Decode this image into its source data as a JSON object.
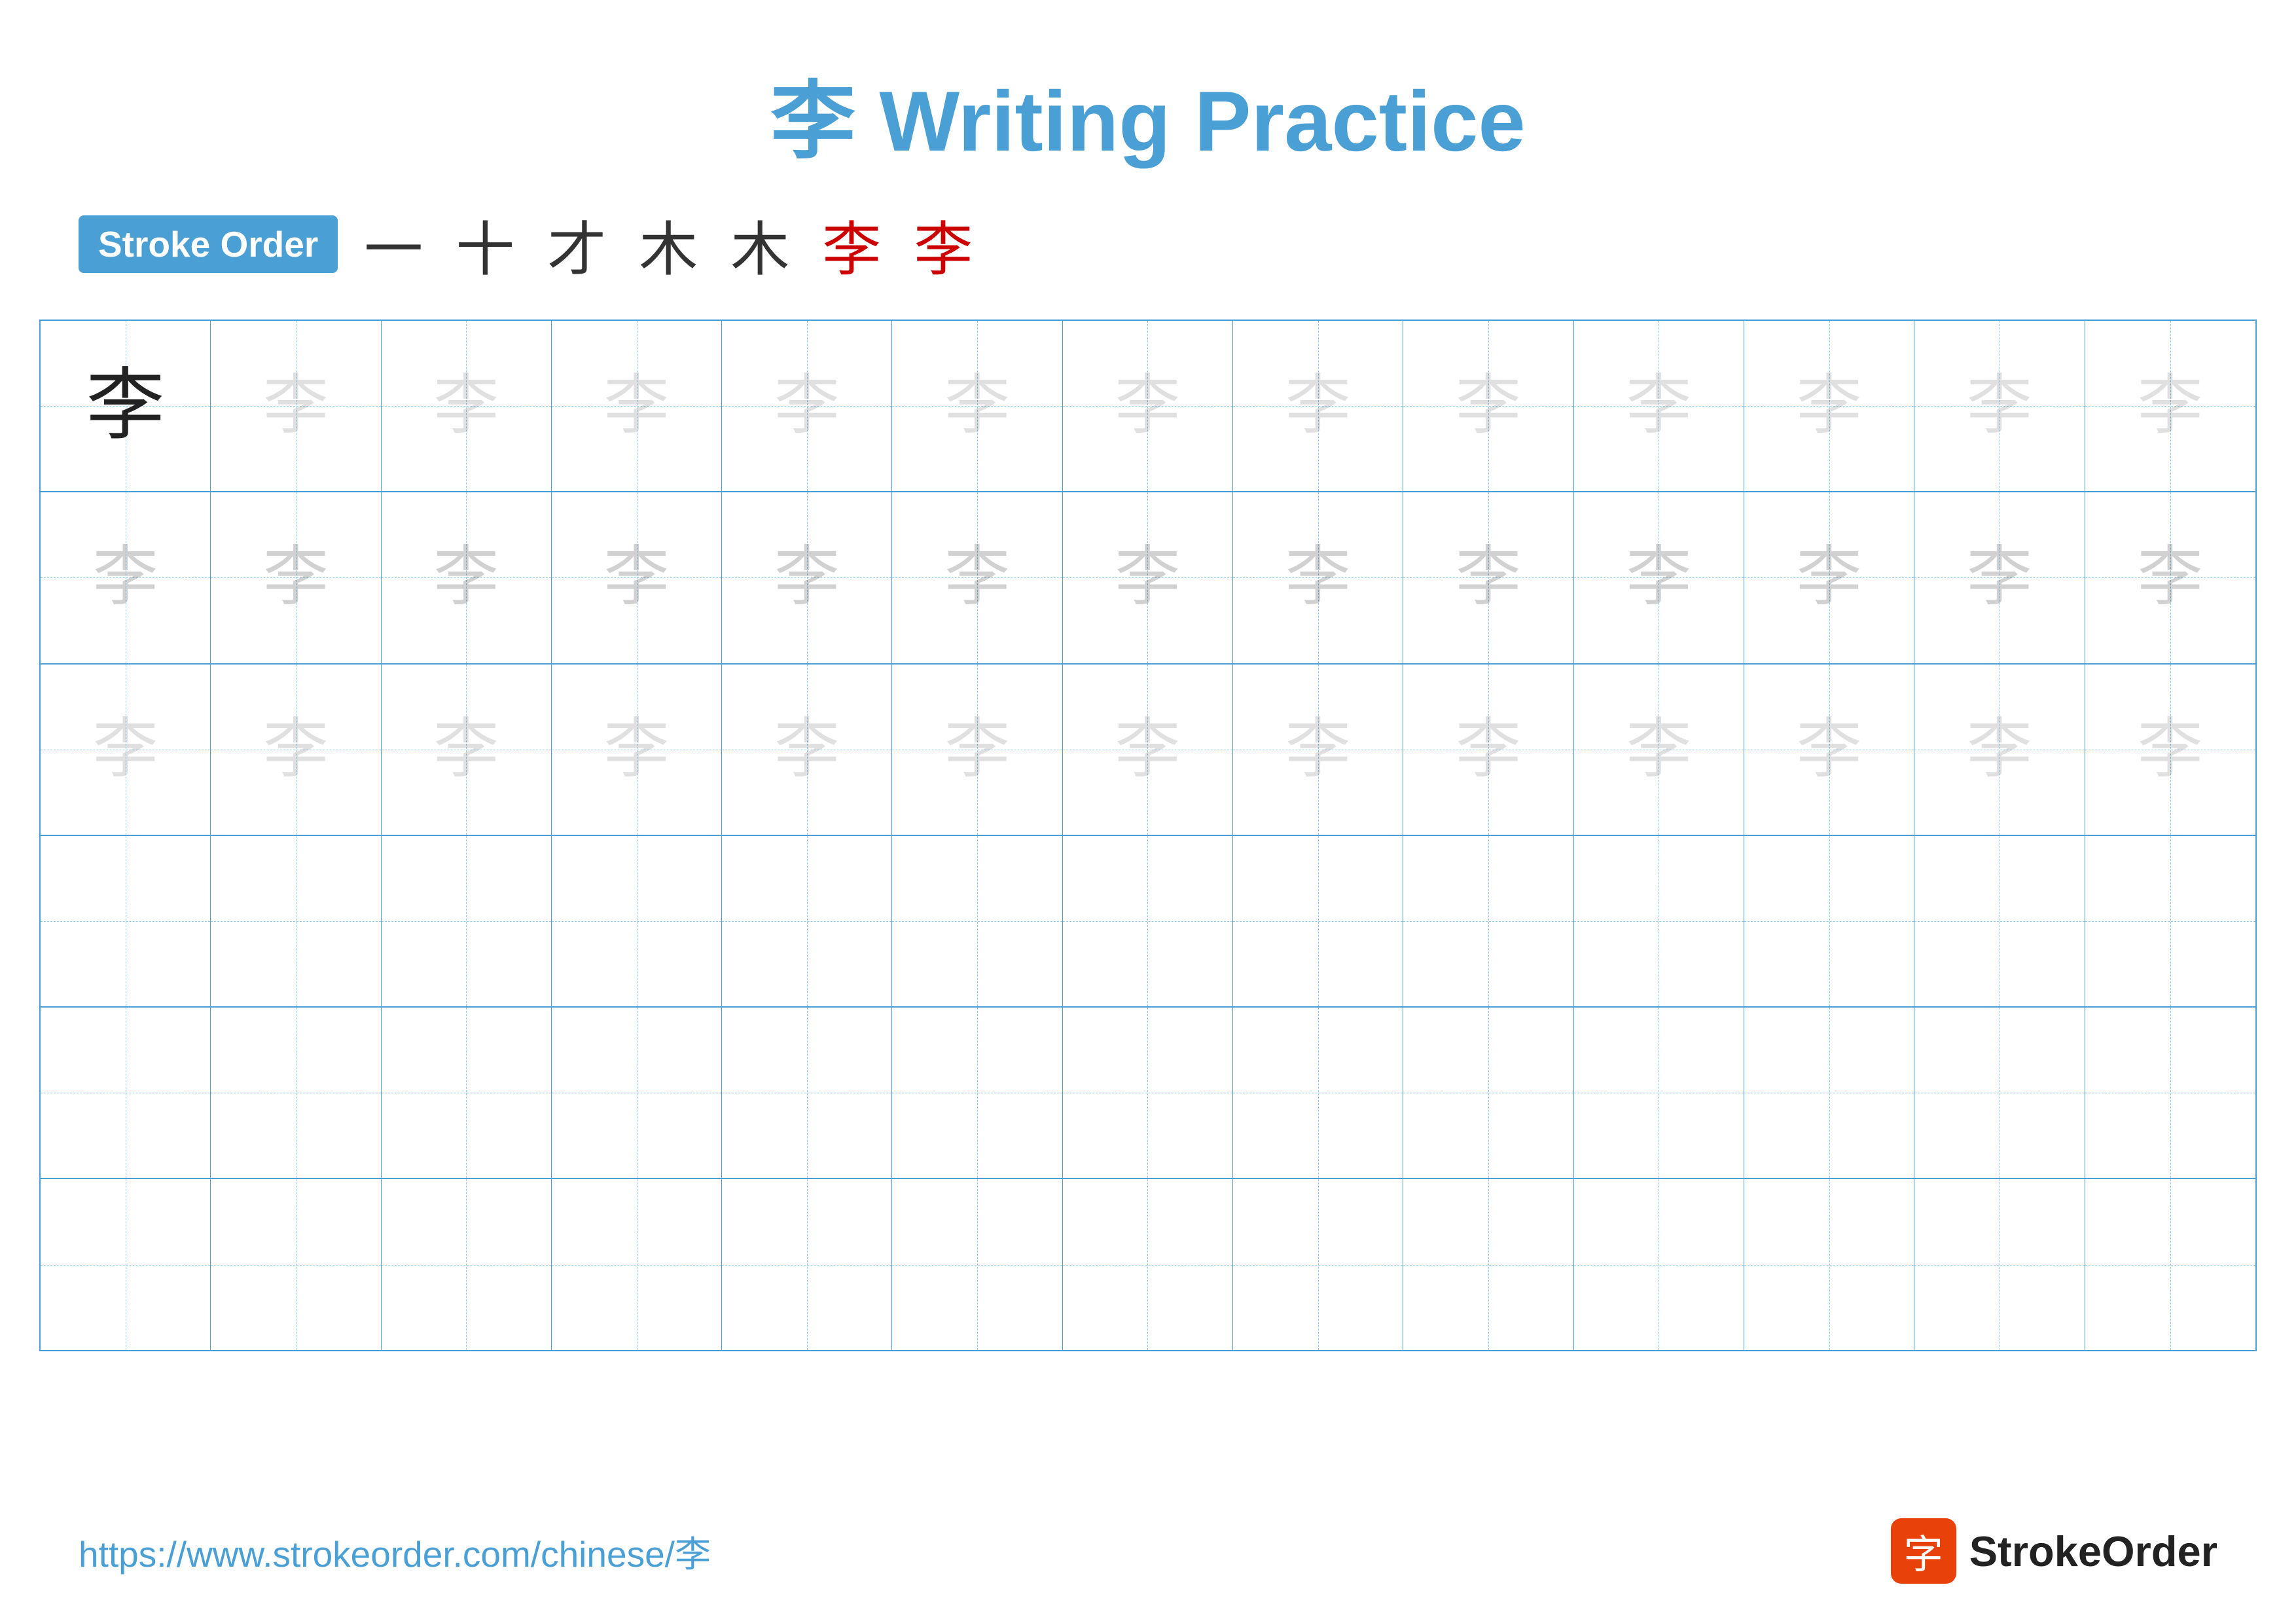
{
  "title": {
    "char": "李",
    "text": "Writing Practice"
  },
  "stroke_order": {
    "badge_label": "Stroke Order",
    "steps": [
      "一",
      "十",
      "才",
      "木",
      "木",
      "李",
      "李"
    ],
    "red_indices": [
      5,
      6
    ]
  },
  "grid": {
    "rows": 6,
    "cols": 13,
    "char": "李",
    "filled_rows": 3,
    "first_cell_dark": true
  },
  "footer": {
    "url": "https://www.strokeorder.com/chinese/李",
    "logo_char": "字",
    "logo_text": "StrokeOrder"
  }
}
